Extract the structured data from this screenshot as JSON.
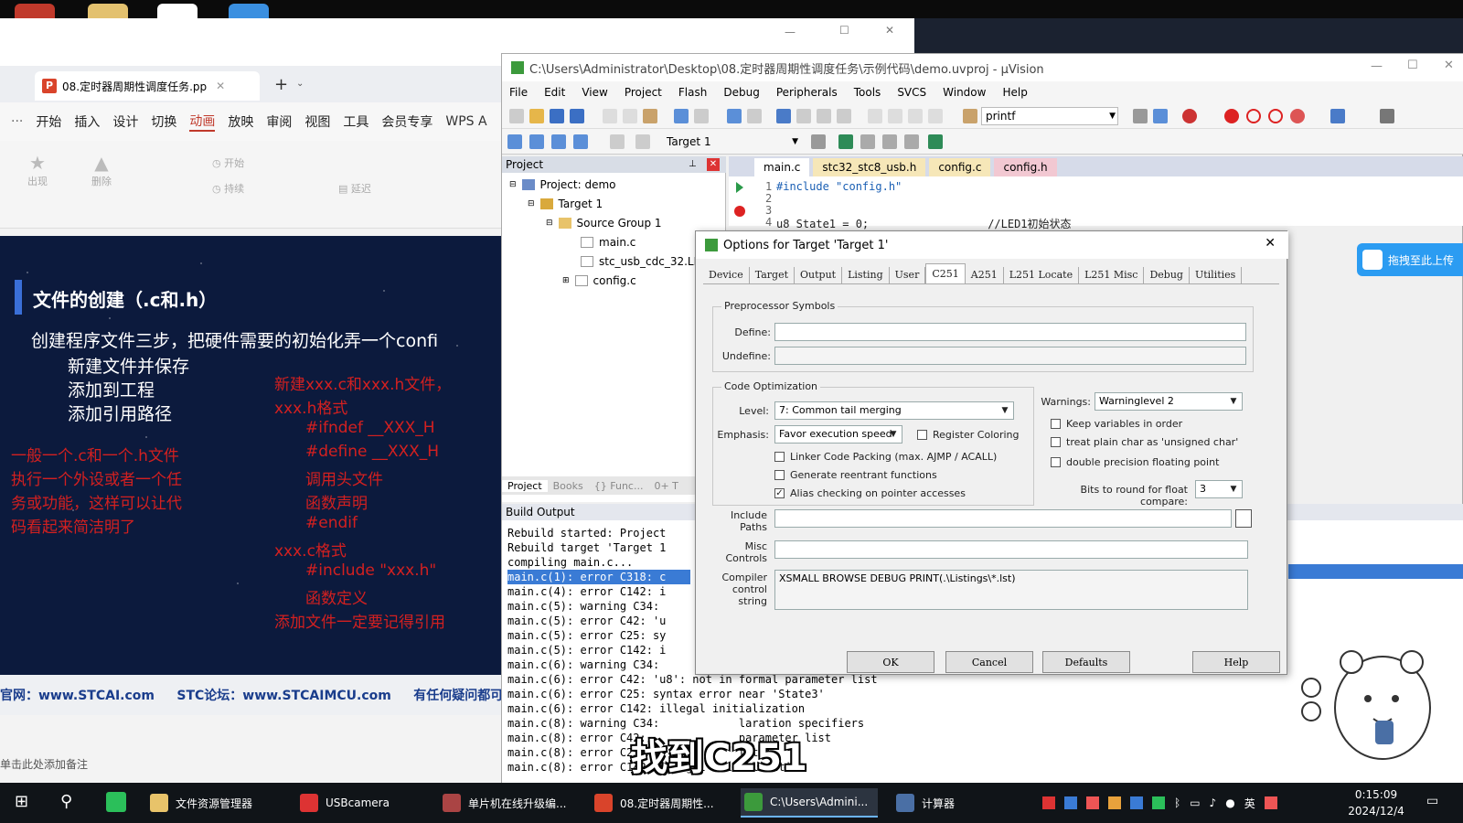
{
  "ppt": {
    "tab_title": "08.定时器周期性调度任务.pp",
    "menu": [
      "开始",
      "插入",
      "设计",
      "切换",
      "动画",
      "放映",
      "审阅",
      "视图",
      "工具",
      "会员专享",
      "WPS A"
    ],
    "active_menu": "动画",
    "ribbon": [
      "出现",
      "删除",
      "开始",
      "持续",
      "延迟"
    ],
    "slide": {
      "heading": "文件的创建（.c和.h）",
      "line1": "创建程序文件三步，把硬件需要的初始化弄一个confi",
      "steps": [
        "新建文件并保存",
        "添加到工程",
        "添加引用路径"
      ],
      "left_red": [
        "一般一个.c和一个.h文件",
        "执行一个外设或者一个任",
        "务或功能，这样可以让代",
        "码看起来简洁明了"
      ],
      "right_red": [
        "新建xxx.c和xxx.h文件，",
        "xxx.h格式",
        "#ifndef __XXX_H",
        "#define __XXX_H",
        "调用头文件",
        "函数声明",
        "#endif",
        "xxx.c格式",
        "#include \"xxx.h\"",
        "函数定义",
        "添加文件一定要记得引用"
      ]
    },
    "footer": "官网：www.STCAI.com     STC论坛：www.STCAIMCU.com     有任何疑问都可以",
    "notes": "单击此处添加备注"
  },
  "uv": {
    "title": "C:\\Users\\Administrator\\Desktop\\08.定时器周期性调度任务\\示例代码\\demo.uvproj - µVision",
    "menu": [
      "File",
      "Edit",
      "View",
      "Project",
      "Flash",
      "Debug",
      "Peripherals",
      "Tools",
      "SVCS",
      "Window",
      "Help"
    ],
    "find_text": "printf",
    "target_select": "Target 1",
    "project_header": "Project",
    "tree": [
      "Project: demo",
      "Target 1",
      "Source Group 1",
      "main.c",
      "stc_usb_cdc_32.LI",
      "config.c"
    ],
    "panel_tabs": [
      "Project",
      "Books",
      "{} Func...",
      "0+ T"
    ],
    "editor_tabs": [
      "main.c",
      "stc32_stc8_usb.h",
      "config.c",
      "config.h"
    ],
    "code": [
      {
        "n": "1",
        "t": "#include \"config.h\""
      },
      {
        "n": "2",
        "t": ""
      },
      {
        "n": "3",
        "t": ""
      },
      {
        "n": "4",
        "t": "u8 State1 = 0;                  //LED1初始状态"
      }
    ],
    "build_header": "Build Output",
    "build_lines": [
      "Rebuild started: Project",
      "Rebuild target 'Target 1",
      "compiling main.c...",
      "main.c(1): error C318: c",
      "main.c(4): error C142: i",
      "main.c(5): warning C34:",
      "main.c(5): error C42: 'u",
      "main.c(5): error C25: sy",
      "main.c(5): error C142: i",
      "main.c(6): warning C34:",
      "main.c(6): error C42: 'u8': not in formal parameter list",
      "main.c(6): error C25: syntax error near 'State3'",
      "main.c(6): error C142: illegal initialization",
      "main.c(8): warning C34:            laration specifiers",
      "main.c(8): error C42:              parameter list",
      "main.c(8): error C25:              tate'",
      "main.c(8): error C142: illegal initialization"
    ]
  },
  "dialog": {
    "title": "Options for Target 'Target 1'",
    "tabs": [
      "Device",
      "Target",
      "Output",
      "Listing",
      "User",
      "C251",
      "A251",
      "L251 Locate",
      "L251 Misc",
      "Debug",
      "Utilities"
    ],
    "active_tab": "C251",
    "preproc_label": "Preprocessor Symbols",
    "define_label": "Define:",
    "undefine_label": "Undefine:",
    "codeopt_label": "Code Optimization",
    "level_label": "Level:",
    "level_value": "7: Common tail merging",
    "emphasis_label": "Emphasis:",
    "emphasis_value": "Favor execution speed",
    "register_coloring": "Register Coloring",
    "linker_packing": "Linker Code Packing (max. AJMP / ACALL)",
    "reentrant": "Generate reentrant functions",
    "alias": "Alias checking on pointer accesses",
    "warnings_label": "Warnings:",
    "warnings_value": "Warninglevel 2",
    "keep_vars": "Keep variables in order",
    "plain_char": "treat plain char as 'unsigned char'",
    "double_prec": "double precision floating point",
    "bits_label": "Bits to round for float compare:",
    "bits_value": "3",
    "include_label": "Include\nPaths",
    "misc_label": "Misc\nControls",
    "ccs_label": "Compiler\ncontrol\nstring",
    "ccs_value": "XSMALL BROWSE DEBUG PRINT(.\\Listings\\*.lst)",
    "buttons": [
      "OK",
      "Cancel",
      "Defaults",
      "Help"
    ]
  },
  "subtitle": "找到C251",
  "share_label": "拖拽至此上传",
  "taskbar": {
    "apps": [
      "文件资源管理器",
      "USBcamera",
      "单片机在线升级编...",
      "08.定时器周期性...",
      "C:\\Users\\Admini...",
      "计算器"
    ],
    "time": "0:15:09",
    "date": "2024/12/4",
    "ime": "英"
  }
}
